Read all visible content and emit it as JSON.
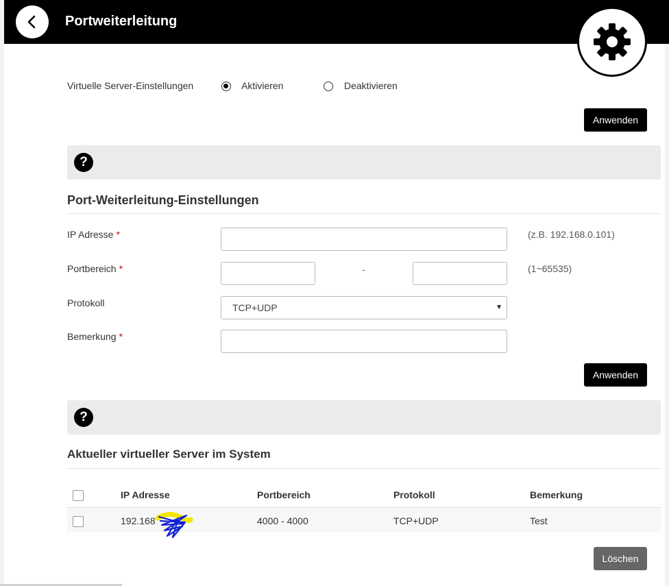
{
  "header": {
    "title": "Portweiterleitung",
    "back_icon": "chevron-left-icon",
    "settings_icon": "gear-icon"
  },
  "virtual_server": {
    "label": "Virtuelle Server-Einstellungen",
    "options": [
      "Aktivieren",
      "Deaktivieren"
    ],
    "selected": "Aktivieren",
    "apply_label": "Anwenden"
  },
  "port_forwarding": {
    "title": "Port-Weiterleitung-Einstellungen",
    "ip_label": "IP Adresse",
    "ip_value": "",
    "ip_hint": "(z.B. 192.168.0.101)",
    "port_label": "Portbereich",
    "port_from": "",
    "port_to": "",
    "port_separator": "-",
    "port_hint": "(1~65535)",
    "protocol_label": "Protokoll",
    "protocol_value": "TCP+UDP",
    "remark_label": "Bemerkung",
    "remark_value": "",
    "required_marker": "*",
    "apply_label": "Anwenden"
  },
  "help": {
    "symbol": "?"
  },
  "current_servers": {
    "title": "Aktueller virtueller Server im System",
    "columns": [
      "IP Adresse",
      "Portbereich",
      "Protokoll",
      "Bemerkung"
    ],
    "rows": [
      {
        "ip": "192.168",
        "ports": "4000 - 4000",
        "protocol": "TCP+UDP",
        "remark": "Test"
      }
    ],
    "delete_label": "Löschen"
  },
  "colors": {
    "header_bg": "#000000",
    "help_bar_bg": "#ebebeb",
    "delete_button": "#666666",
    "required": "#cc0000"
  }
}
